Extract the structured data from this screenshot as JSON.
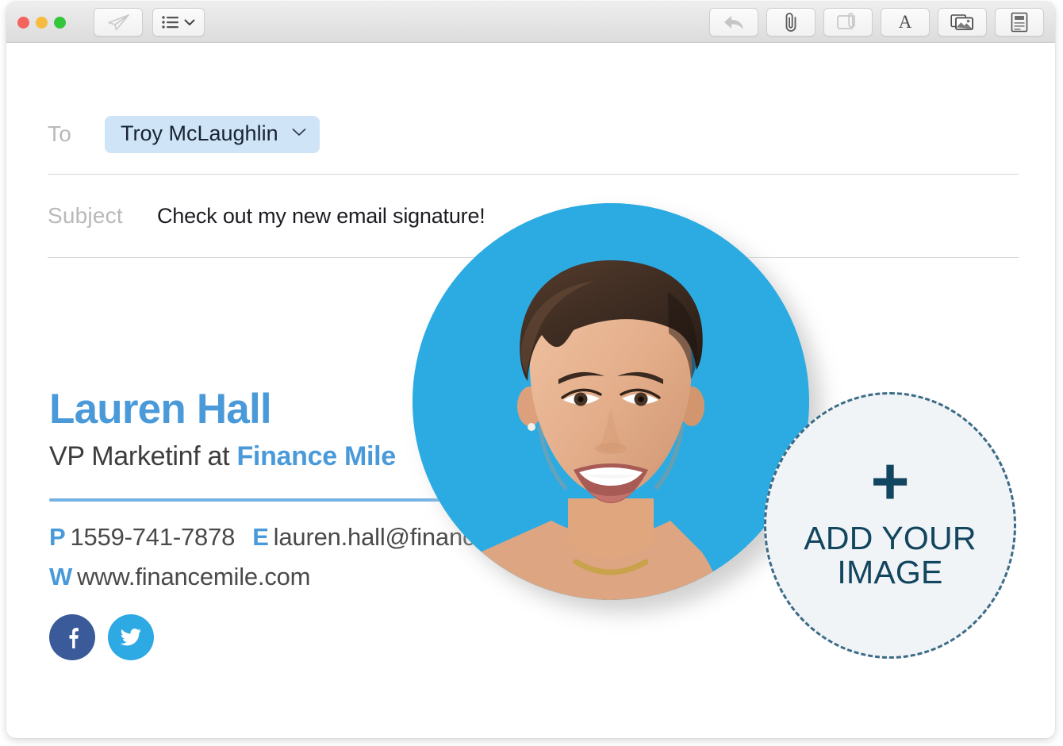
{
  "window": {
    "traffic_lights": [
      {
        "name": "close",
        "color": "#f4635e"
      },
      {
        "name": "minimize",
        "color": "#f7bb3f"
      },
      {
        "name": "zoom",
        "color": "#35c63b"
      }
    ]
  },
  "toolbar": {
    "left_buttons": [
      {
        "name": "send-button",
        "icon": "paper-plane-icon",
        "state": "disabled"
      },
      {
        "name": "list-options-button",
        "icon": "list-icon",
        "secondary_icon": "chevron-down-icon"
      }
    ],
    "right_buttons": [
      {
        "name": "reply-button",
        "icon": "reply-arrow-icon",
        "state": "disabled"
      },
      {
        "name": "attach-button",
        "icon": "paperclip-icon"
      },
      {
        "name": "attach-card-button",
        "icon": "card-paperclip-icon",
        "state": "disabled"
      },
      {
        "name": "format-text-button",
        "icon": "font-a-icon",
        "label": "A"
      },
      {
        "name": "insert-photo-button",
        "icon": "photos-icon"
      },
      {
        "name": "stationery-button",
        "icon": "stationery-icon"
      }
    ]
  },
  "compose": {
    "to": {
      "label": "To",
      "recipient": "Troy McLaughlin",
      "chevron": "chevron-down-icon"
    },
    "subject": {
      "label": "Subject",
      "value": "Check out my new email signature!"
    }
  },
  "signature": {
    "name": "Lauren Hall",
    "title_prefix": "VP Marketinf at ",
    "company": "Finance Mile",
    "phone_key": "P",
    "phone": "1559-741-7878",
    "email_key": "E",
    "email": "lauren.hall@financemile.com",
    "web_key": "W",
    "web": "www.financemile.com",
    "socials": [
      {
        "name": "facebook-icon",
        "glyph": "f",
        "color": "#3b5a9a"
      },
      {
        "name": "twitter-icon",
        "glyph": "twitter-bird",
        "color": "#2daae4"
      }
    ],
    "accent_color": "#4a9ada",
    "rule_color": "#74b3e3"
  },
  "portrait": {
    "alt": "smiling woman with short dark hair",
    "background_color": "#2cabe2"
  },
  "add_image_placeholder": {
    "plus": "+",
    "line1": "ADD YOUR",
    "line2": "IMAGE",
    "text_color": "#12455f",
    "fill_color": "#f1f4f6"
  }
}
